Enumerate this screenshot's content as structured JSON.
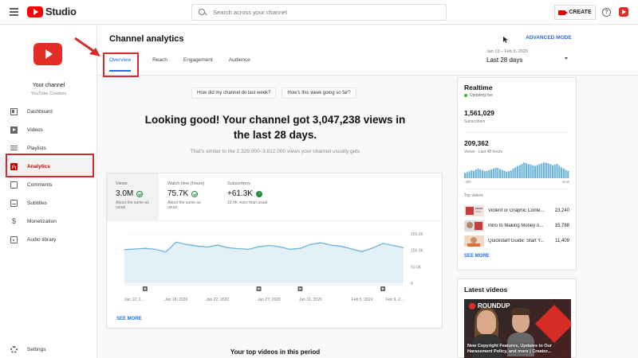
{
  "app": {
    "logo_text": "Studio"
  },
  "search": {
    "placeholder": "Search across your channel"
  },
  "topbar": {
    "create_label": "CREATE",
    "help_glyph": "?"
  },
  "channel": {
    "name": "Your channel",
    "subtitle": "YouTube Creators"
  },
  "sidebar": {
    "items": [
      {
        "label": "Dashboard",
        "icon": "dashboard-icon"
      },
      {
        "label": "Videos",
        "icon": "videos-icon"
      },
      {
        "label": "Playlists",
        "icon": "playlists-icon"
      },
      {
        "label": "Analytics",
        "icon": "analytics-icon",
        "active": true
      },
      {
        "label": "Comments",
        "icon": "comments-icon"
      },
      {
        "label": "Subtitles",
        "icon": "subtitles-icon"
      },
      {
        "label": "Monetization",
        "icon": "monetization-icon"
      },
      {
        "label": "Audio library",
        "icon": "audio-library-icon"
      }
    ],
    "settings_label": "Settings",
    "money_glyph": "$"
  },
  "header": {
    "title": "Channel analytics",
    "advanced_label": "ADVANCED MODE",
    "tabs": [
      "Overview",
      "Reach",
      "Engagement",
      "Audience"
    ],
    "active_tab": "Overview",
    "date_range_small": "Jan 13 – Feb 9, 2020",
    "date_range_main": "Last 28 days"
  },
  "chips": [
    "How did my channel do last week?",
    "How's this week going so far?"
  ],
  "summary": {
    "headline": "Looking good! Your channel got 3,047,238 views in the last 28 days.",
    "subline": "That's similar to the 2,329,000–3,812,000 views your channel usually gets"
  },
  "metrics": [
    {
      "label": "Views",
      "value": "3.0M",
      "note": "About the same as usual",
      "status": "check-icon"
    },
    {
      "label": "Watch time (hours)",
      "value": "75.7K",
      "note": "About the same as usual",
      "status": "check-icon"
    },
    {
      "label": "Subscribers",
      "value": "+61.3K",
      "note": "10.9K more than usual",
      "status": "up-icon",
      "status_glyph": "↑"
    }
  ],
  "overview_see_more": "SEE MORE",
  "chart_data": {
    "type": "line",
    "x": [
      "Jan 13",
      "Jan 14",
      "Jan 15",
      "Jan 16",
      "Jan 17",
      "Jan 18",
      "Jan 19",
      "Jan 20",
      "Jan 21",
      "Jan 22",
      "Jan 23",
      "Jan 24",
      "Jan 25",
      "Jan 26",
      "Jan 27",
      "Jan 28",
      "Jan 29",
      "Jan 30",
      "Jan 31",
      "Feb 1",
      "Feb 2",
      "Feb 3",
      "Feb 4",
      "Feb 5",
      "Feb 6",
      "Feb 7",
      "Feb 8",
      "Feb 9"
    ],
    "values": [
      102000,
      104000,
      106000,
      103000,
      95000,
      125000,
      118000,
      113000,
      110000,
      116000,
      108000,
      105000,
      103000,
      111000,
      115000,
      111000,
      103000,
      106000,
      118000,
      123000,
      116000,
      112000,
      104000,
      96000,
      107000,
      121000,
      115000,
      108000
    ],
    "x_tick_labels": [
      "Jan 12, 2...",
      "Jan 18, 2020",
      "Jan 22, 2020",
      "Jan 27, 2020",
      "Jan 31, 2020",
      "Feb 5, 2020",
      "Feb 9, 2..."
    ],
    "y_tick_labels": [
      "150.0K",
      "100.0K",
      "50.0K",
      "0"
    ],
    "ylim": [
      0,
      150000
    ],
    "grid": true,
    "color": "#6ab4d8",
    "fill": "#e3f0f8",
    "video_markers": [
      "Jan 15",
      "Jan 26",
      "Jan 30",
      "Feb 7"
    ]
  },
  "top_videos_heading": "Your top videos in this period",
  "realtime": {
    "title": "Realtime",
    "status": "Updating live",
    "subscribers": "1,561,029",
    "subscribers_label": "Subscribers",
    "views": "209,362",
    "views_label": "Views · Last 48 hours",
    "axis_start": "-48h",
    "axis_end": "Now",
    "bars": [
      0.3,
      0.35,
      0.4,
      0.45,
      0.42,
      0.5,
      0.55,
      0.5,
      0.45,
      0.4,
      0.42,
      0.46,
      0.5,
      0.55,
      0.6,
      0.58,
      0.52,
      0.48,
      0.42,
      0.38,
      0.4,
      0.45,
      0.55,
      0.62,
      0.7,
      0.75,
      0.82,
      0.9,
      0.85,
      0.8,
      0.78,
      0.72,
      0.7,
      0.75,
      0.8,
      0.85,
      0.9,
      0.88,
      0.85,
      0.8,
      0.75,
      0.78,
      0.82,
      0.7,
      0.62,
      0.55,
      0.48,
      0.42
    ],
    "top_videos_label": "Top videos",
    "top_videos": [
      {
        "title": "Violent or Graphic Conte...",
        "views": "23,240"
      },
      {
        "title": "Intro to Making Money o...",
        "views": "15,788"
      },
      {
        "title": "Quickstart Guide: Start Y...",
        "views": "11,409"
      }
    ],
    "see_more": "SEE MORE"
  },
  "latest": {
    "title": "Latest videos",
    "thumb_badge": "ROUNDUP",
    "caption": "New Copyright Features, Updates to Our Harassment Policy, and more | Creator..."
  },
  "colors": {
    "accent": "#1a73e8",
    "brand": "#ff0000",
    "highlight_box": "#d12d2d",
    "positive": "#1e8e3e"
  }
}
